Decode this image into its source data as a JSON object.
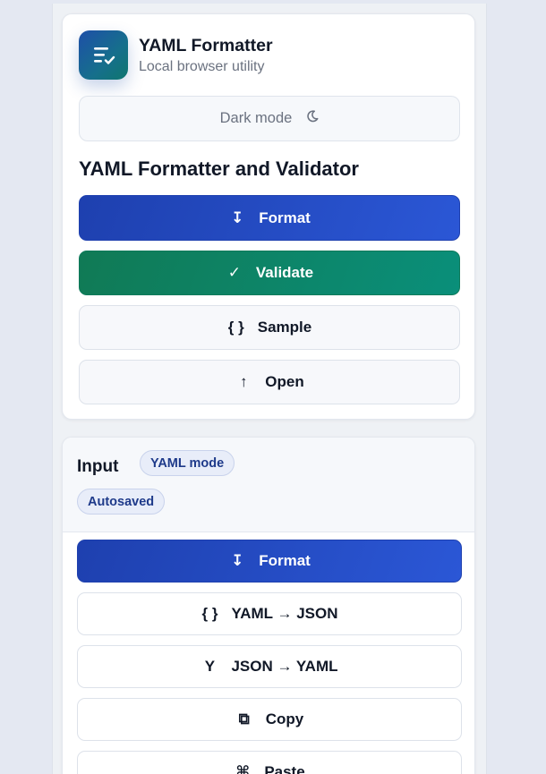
{
  "app": {
    "title": "YAML Formatter",
    "subtitle": "Local browser utility",
    "logo_icon": "list-check-icon"
  },
  "theme_toggle": {
    "label": "Dark mode",
    "icon": "moon-icon"
  },
  "tools": {
    "title": "YAML Formatter and Validator",
    "buttons": [
      {
        "label": "Format",
        "icon": "arrow-down-icon",
        "glyph": "↧"
      },
      {
        "label": "Validate",
        "icon": "check-icon",
        "glyph": "✓"
      },
      {
        "label": "Sample",
        "icon": "braces-icon",
        "glyph": "{ }"
      },
      {
        "label": "Open",
        "icon": "arrow-up-icon",
        "glyph": "↑"
      }
    ]
  },
  "input": {
    "label": "Input",
    "badges": [
      "YAML mode",
      "Autosaved"
    ],
    "actions": [
      {
        "label": "Format",
        "icon": "arrow-down-icon",
        "glyph": "↧"
      },
      {
        "label": "YAML → JSON",
        "icon": "braces-icon",
        "glyph": "{ }"
      },
      {
        "label": "JSON → YAML",
        "icon": "yaml-icon",
        "glyph": "Y"
      },
      {
        "label": "Copy",
        "icon": "copy-icon",
        "glyph": "⧉"
      },
      {
        "label": "Paste",
        "icon": "command-icon",
        "glyph": "⌘"
      }
    ]
  },
  "colors": {
    "primary": "#1e40af",
    "success": "#0f7f5f",
    "background": "#e4e8f2"
  }
}
